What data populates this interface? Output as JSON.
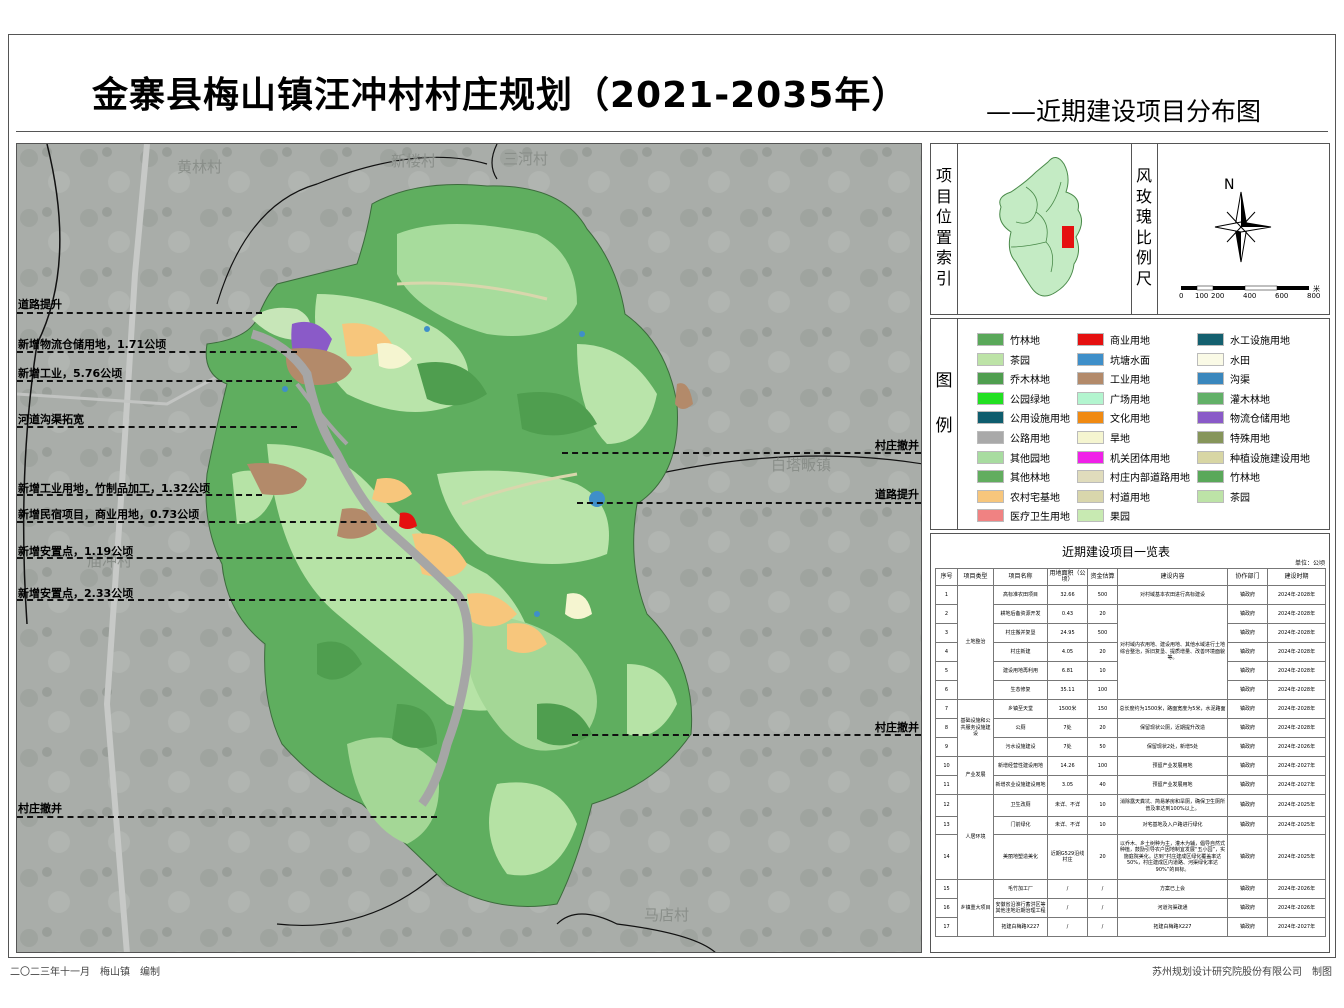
{
  "title": "金寨县梅山镇汪冲村村庄规划（2021-2035年）",
  "subtitle": "——近期建设项目分布图",
  "map": {
    "place_labels": [
      "黄林村",
      "新楼村",
      "三河村",
      "白塔畈镇",
      "庙冲村",
      "马店村"
    ],
    "callouts": {
      "road_upgrade_1": "道路提升",
      "logistics": "新增物流仓储用地，1.71公顷",
      "industry": "新增工业，5.76公顷",
      "river": "河道沟渠拓宽",
      "village_remove_1": "村庄撤并",
      "bamboo_industry": "新增工业用地，竹制品加工，1.32公顷",
      "road_upgrade_2": "道路提升",
      "homestay": "新增民宿项目，商业用地，0.73公顷",
      "resettle_1": "新增安置点，1.19公顷",
      "resettle_2": "新增安置点，2.33公顷",
      "village_remove_2": "村庄撤并",
      "village_remove_3": "村庄撤并"
    }
  },
  "index_panel": {
    "label": "项目位置索引",
    "scale_label": "风玫瑰比例尺",
    "north": "N",
    "scale_ticks": [
      "0",
      "100",
      "200",
      "400",
      "600",
      "800"
    ],
    "scale_unit": "米"
  },
  "legend": {
    "label": "图例",
    "items": [
      {
        "name": "竹林地",
        "color": "#5aa85a"
      },
      {
        "name": "茶园",
        "color": "#bde3a7"
      },
      {
        "name": "乔木林地",
        "color": "#4f9e4f"
      },
      {
        "name": "公园绿地",
        "color": "#22e022"
      },
      {
        "name": "公用设施用地",
        "color": "#0e5d6e"
      },
      {
        "name": "公路用地",
        "color": "#a9a9a9"
      },
      {
        "name": "其他园地",
        "color": "#a8dca0"
      },
      {
        "name": "其他林地",
        "color": "#62ad5f"
      },
      {
        "name": "农村宅基地",
        "color": "#f7c67c"
      },
      {
        "name": "医疗卫生用地",
        "color": "#f08282"
      },
      {
        "name": "商业用地",
        "color": "#e51010"
      },
      {
        "name": "坑塘水面",
        "color": "#3f8fc9"
      },
      {
        "name": "工业用地",
        "color": "#b38a6a"
      },
      {
        "name": "广场用地",
        "color": "#b3f5cf"
      },
      {
        "name": "文化用地",
        "color": "#f08a12"
      },
      {
        "name": "旱地",
        "color": "#f5f5d0"
      },
      {
        "name": "机关团体用地",
        "color": "#f020e8"
      },
      {
        "name": "村庄内部道路用地",
        "color": "#e0dcbc"
      },
      {
        "name": "村道用地",
        "color": "#d9d6ac"
      },
      {
        "name": "果园",
        "color": "#c8eab2"
      },
      {
        "name": "水工设施用地",
        "color": "#14606f"
      },
      {
        "name": "水田",
        "color": "#fafae6"
      },
      {
        "name": "沟渠",
        "color": "#3a87bd"
      },
      {
        "name": "灌木林地",
        "color": "#62b068"
      },
      {
        "name": "物流仓储用地",
        "color": "#8a5ac8"
      },
      {
        "name": "特殊用地",
        "color": "#86955a"
      },
      {
        "name": "种植设施建设用地",
        "color": "#d8d6a4"
      },
      {
        "name": "竹林地",
        "color": "#5aa85a"
      },
      {
        "name": "茶园",
        "color": "#bde3a7"
      }
    ]
  },
  "table": {
    "title": "近期建设项目一览表",
    "unit": "单位：公顷",
    "headers": [
      "序号",
      "项目类型",
      "项目名称",
      "用地面积（公顷）",
      "资金估算",
      "建设内容",
      "协作部门",
      "建设时期"
    ],
    "rows": [
      {
        "no": "1",
        "type": "土地整治",
        "name": "高标准农田项目",
        "area": "32.66",
        "fund": "500",
        "content": "对村域基本农田进行高标建设",
        "dept": "镇政府",
        "period": "2024年-2028年"
      },
      {
        "no": "2",
        "type": "",
        "name": "耕地后备资源开发",
        "area": "0.43",
        "fund": "20",
        "content": "对村域内农用地、建设用地、其他水域进行土地综合整治，拆旧复垦、提质增量、改善环境面貌等。",
        "dept": "镇政府",
        "period": "2024年-2028年"
      },
      {
        "no": "3",
        "type": "",
        "name": "村庄搬并复垦",
        "area": "24.95",
        "fund": "500",
        "content": "",
        "dept": "镇政府",
        "period": "2024年-2028年"
      },
      {
        "no": "4",
        "type": "",
        "name": "村庄新建",
        "area": "4.05",
        "fund": "20",
        "content": "",
        "dept": "镇政府",
        "period": "2024年-2028年"
      },
      {
        "no": "5",
        "type": "",
        "name": "建设用地再利用",
        "area": "6.81",
        "fund": "10",
        "content": "",
        "dept": "镇政府",
        "period": "2024年-2028年"
      },
      {
        "no": "6",
        "type": "",
        "name": "生态修复",
        "area": "35.11",
        "fund": "100",
        "content": "",
        "dept": "镇政府",
        "period": "2024年-2028年"
      },
      {
        "no": "7",
        "type": "基础设施和公共服务设施建设",
        "name": "乡镇至天堂",
        "area": "1500米",
        "fund": "150",
        "content": "总长度约为1500米，路面宽度为5米，水泥路面",
        "dept": "镇政府",
        "period": "2024年-2028年"
      },
      {
        "no": "8",
        "type": "",
        "name": "公厕",
        "area": "7处",
        "fund": "20",
        "content": "保留现状公厕，近期提升改造",
        "dept": "镇政府",
        "period": "2024年-2028年"
      },
      {
        "no": "9",
        "type": "",
        "name": "污水设施建设",
        "area": "7处",
        "fund": "50",
        "content": "保留现状2处，新增5处",
        "dept": "镇政府",
        "period": "2024年-2026年"
      },
      {
        "no": "10",
        "type": "产业发展",
        "name": "新增经营性建设用地",
        "area": "14.26",
        "fund": "100",
        "content": "预留产业发展用地",
        "dept": "镇政府",
        "period": "2024年-2027年"
      },
      {
        "no": "11",
        "type": "",
        "name": "新增农业设施建设用地",
        "area": "3.05",
        "fund": "40",
        "content": "预留产业发展用地",
        "dept": "镇政府",
        "period": "2024年-2027年"
      },
      {
        "no": "12",
        "type": "人居环境",
        "name": "卫生改厕",
        "area": "未详、不详",
        "fund": "10",
        "content": "消除露天粪坑、简易茅房和旱厕，确保卫生厕所普及率达到100%以上。",
        "dept": "镇政府",
        "period": "2024年-2025年"
      },
      {
        "no": "13",
        "type": "",
        "name": "门前绿化",
        "area": "未详、不详",
        "fund": "10",
        "content": "对宅基地及入户路进行绿化",
        "dept": "镇政府",
        "period": "2024年-2025年"
      },
      {
        "no": "14",
        "type": "",
        "name": "美丽地塑造美化",
        "area": "近期G529沿线村庄",
        "fund": "20",
        "content": "以乔木、乡土树种为主，灌木为辅，倡导自然式种植，鼓励引导农户因地制宜发展“五小园”，实施庭院美化。达到“村庄建成区绿化覆盖率达50%，村庄建成区内道路、河渠绿化率达90%”的目标。",
        "dept": "镇政府",
        "period": "2024年-2025年"
      },
      {
        "no": "15",
        "type": "乡镇重大项目",
        "name": "毛竹加工厂",
        "area": "/",
        "fund": "/",
        "content": "方案已上会",
        "dept": "镇政府",
        "period": "2024年-2026年"
      },
      {
        "no": "16",
        "type": "",
        "name": "安徽省沿淮行蓄洪区等其他洼地近期治理工程",
        "area": "/",
        "fund": "/",
        "content": "河道沟渠疏通",
        "dept": "镇政府",
        "period": "2024年-2026年"
      },
      {
        "no": "17",
        "type": "",
        "name": "拓建白梅路X227",
        "area": "/",
        "fund": "/",
        "content": "拓建白梅路X227",
        "dept": "镇政府",
        "period": "2024年-2027年"
      }
    ]
  },
  "footer": {
    "left": "二〇二三年十一月　梅山镇　编制",
    "right": "苏州规划设计研究院股份有限公司　制图"
  }
}
